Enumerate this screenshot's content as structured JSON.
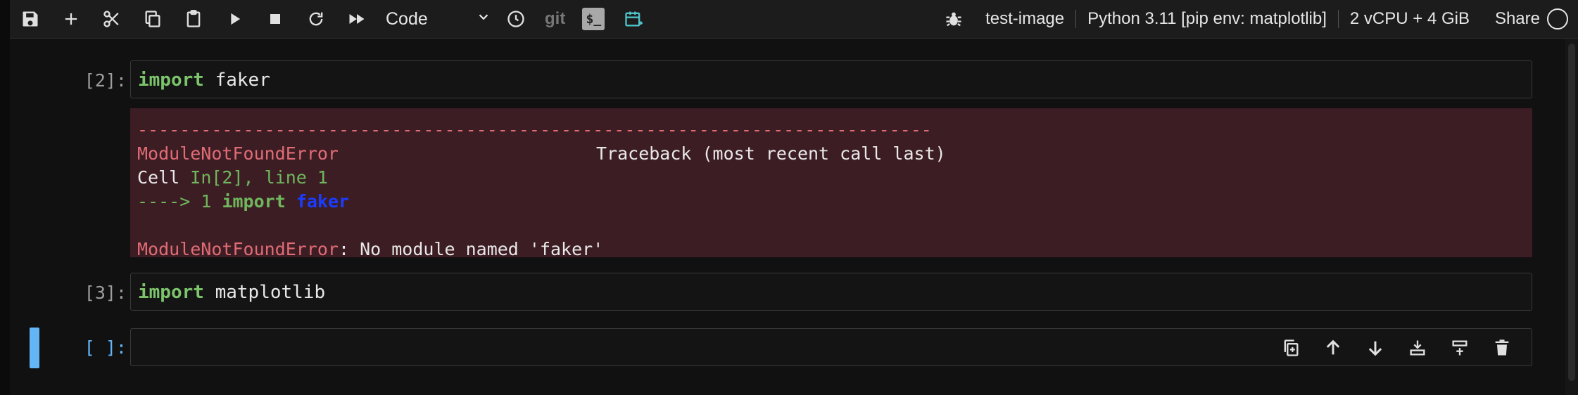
{
  "toolbar": {
    "cell_type": "Code",
    "git_label": "git",
    "terminal_glyph": "$_",
    "kernel_name": "test-image",
    "kernel_env": "Python 3.11 [pip env: matplotlib]",
    "resources": "2 vCPU + 4 GiB",
    "share_label": "Share"
  },
  "cells": [
    {
      "prompt": "[2]:",
      "code": {
        "keyword": "import",
        "module": "faker"
      }
    },
    {
      "prompt": "[3]:",
      "code": {
        "keyword": "import",
        "module": "matplotlib"
      }
    },
    {
      "prompt": "[ ]:",
      "code": ""
    }
  ],
  "error_output": {
    "dashes": "---------------------------------------------------------------------------",
    "error_name": "ModuleNotFoundError",
    "traceback_header": "Traceback (most recent call last)",
    "cell_word": "Cell",
    "cell_ref": "In[2], line 1",
    "arrow": "---->",
    "line_no": "1",
    "import_kw": "import",
    "module": "faker",
    "message_name": "ModuleNotFoundError",
    "message_text": ": No module named 'faker'"
  },
  "icons": {
    "toolbar": [
      "save-icon",
      "add-icon",
      "cut-icon",
      "copy-icon",
      "paste-icon",
      "run-icon",
      "stop-icon",
      "restart-icon",
      "fast-forward-icon",
      "chevron-down-icon",
      "clock-icon",
      "terminal-icon",
      "calendar-add-icon",
      "bug-icon",
      "kernel-status-icon"
    ],
    "cell_tools": [
      "duplicate-icon",
      "arrow-up-icon",
      "arrow-down-icon",
      "insert-above-icon",
      "insert-below-icon",
      "trash-icon"
    ]
  },
  "colors": {
    "background": "#111111",
    "toolbar_bg": "#1c1c1c",
    "error_bg": "#3d1d24",
    "keyword_green": "#7cc46b",
    "error_red": "#e06c75",
    "active_blue": "#64b5f6",
    "teal_icon": "#4fc3c9"
  }
}
